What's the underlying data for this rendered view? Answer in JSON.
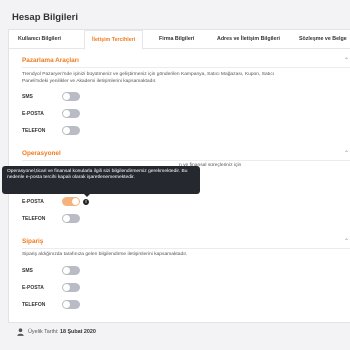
{
  "page": {
    "title": "Hesap Bilgileri"
  },
  "tabs": [
    {
      "label": "Kullanıcı Bilgileri",
      "active": false
    },
    {
      "label": "İletişim Tercihleri",
      "active": true
    },
    {
      "label": "Firma Bilgileri",
      "active": false
    },
    {
      "label": "Adres ve İletişim Bilgileri",
      "active": false
    },
    {
      "label": "Sözleşme ve Belge",
      "active": false
    }
  ],
  "sections": {
    "marketing": {
      "title": "Pazarlama Araçları",
      "description": "Trendyol Pazaryeri'nde işinizi büyütmeniz ve geliştirmeniz için gönderilen Kampanya, Satıcı Mağazası, Kupon, Satıcı Paneli'ndeki yenilikler ve Akademi iletişimlerini kapsamaktadır.",
      "rows": [
        {
          "label": "SMS",
          "enabled": false
        },
        {
          "label": "E-POSTA",
          "enabled": false
        },
        {
          "label": "TELEFON",
          "enabled": false
        }
      ]
    },
    "operational": {
      "title": "Operasyonel",
      "description_visible": "n ve finansal süreçleriniz için",
      "rows": [
        {
          "label": "E-POSTA",
          "enabled": true,
          "locked": true
        },
        {
          "label": "TELEFON",
          "enabled": false
        }
      ],
      "tooltip": "Operasyonel,ticari ve finansal konularla ilgili sizi bilgilendirmemiz gerekmektedir. Bu nedenle e-posta tercihi kapalı olarak işaretlenememektedir."
    },
    "orders": {
      "title": "Sipariş",
      "description": "Sipariş aldığınızda tarafınıza gelen bilgilendirme iletişimlerini kapsamaktadır.",
      "rows": [
        {
          "label": "SMS",
          "enabled": false
        },
        {
          "label": "E-POSTA",
          "enabled": false
        },
        {
          "label": "TELEFON",
          "enabled": false
        }
      ]
    }
  },
  "footer": {
    "member_label": "Üyelik Tarihi:",
    "member_date": "18 Şubat 2020"
  },
  "colors": {
    "accent": "#ef7a1c",
    "toggle_off": "#b9bcc4",
    "toggle_on": "#f6b27c",
    "tooltip_bg": "#262830"
  }
}
